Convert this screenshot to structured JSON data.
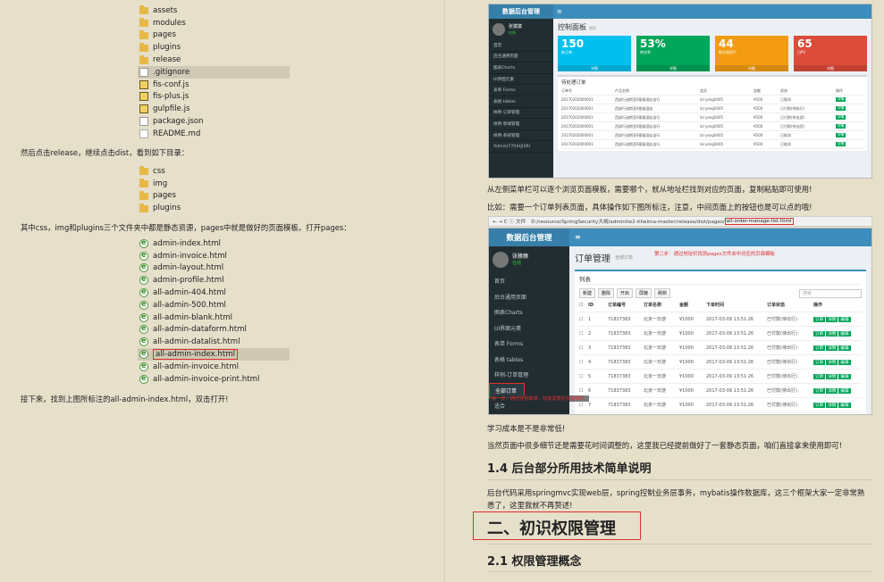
{
  "left": {
    "list1": [
      {
        "name": "assets",
        "type": "folder"
      },
      {
        "name": "modules",
        "type": "folder"
      },
      {
        "name": "pages",
        "type": "folder"
      },
      {
        "name": "plugins",
        "type": "folder"
      },
      {
        "name": "release",
        "type": "folder"
      },
      {
        "name": ".gitignore",
        "type": "file",
        "highlight": true
      },
      {
        "name": "fis-conf.js",
        "type": "js"
      },
      {
        "name": "fis-plus.js",
        "type": "js"
      },
      {
        "name": "gulpfile.js",
        "type": "js"
      },
      {
        "name": "package.json",
        "type": "file"
      },
      {
        "name": "README.md",
        "type": "md"
      }
    ],
    "para1": "然后点击release，继续点击dist，看到如下目录：",
    "list2": [
      {
        "name": "css",
        "type": "folder"
      },
      {
        "name": "img",
        "type": "folder"
      },
      {
        "name": "pages",
        "type": "folder"
      },
      {
        "name": "plugins",
        "type": "folder"
      }
    ],
    "para2": "其中css，img和plugins三个文件夹中都是静态资源，pages中就是做好的页面模板。打开pages：",
    "list3": [
      {
        "name": "admin-index.html"
      },
      {
        "name": "admin-invoice.html"
      },
      {
        "name": "admin-layout.html"
      },
      {
        "name": "admin-profile.html"
      },
      {
        "name": "all-admin-404.html"
      },
      {
        "name": "all-admin-500.html"
      },
      {
        "name": "all-admin-blank.html"
      },
      {
        "name": "all-admin-dataform.html"
      },
      {
        "name": "all-admin-datalist.html"
      },
      {
        "name": "all-admin-index.html",
        "highlight": true
      },
      {
        "name": "all-admin-invoice.html"
      },
      {
        "name": "all-admin-invoice-print.html"
      }
    ],
    "para3": "接下来，找到上图所标注的all-admin-index.html，双击打开!"
  },
  "shot1": {
    "logo": "数据后台管理",
    "user": "张猿猿",
    "online": "在线",
    "nav": [
      "首页",
      "后台通用页面",
      "图表Charts",
      "UI界面元素",
      "表单 Forms",
      "表格 tables",
      "样例-订单管理",
      "样例-新闻管理",
      "样例-系统管理",
      "Admin(770)HJ(SR)"
    ],
    "title": "控制面板",
    "title_small": "首页",
    "boxes": [
      {
        "num": "150",
        "label": "新订单",
        "foot": "详细",
        "color": "#00c0ef"
      },
      {
        "num": "53%",
        "label": "转化率",
        "foot": "详细",
        "color": "#00a65a"
      },
      {
        "num": "44",
        "label": "新注册用户",
        "foot": "详细",
        "color": "#f39c12"
      },
      {
        "num": "65",
        "label": "日PV",
        "foot": "详细",
        "color": "#dd4b39"
      }
    ],
    "table_title": "待处理订单",
    "cols": [
      "订单号",
      "产品名称",
      "会员",
      "金额",
      "状态",
      "操作"
    ],
    "rows": [
      [
        "20170202000001",
        "西部行迪斯亚6星级酒店自行",
        "lal yeng0405",
        "¥500",
        "已取消",
        "详情"
      ],
      [
        "20170202000001",
        "西部行迪斯亚6星级酒店",
        "lal yeng0405",
        "¥500",
        "已付款(待执行)",
        "详情"
      ],
      [
        "20170202000001",
        "西部行迪斯亚6星级酒店自行",
        "lal yeng0405",
        "¥500",
        "已付款(待出游)",
        "详情"
      ],
      [
        "20170202000001",
        "西部行迪斯亚6星级酒店自行",
        "lal yeng0405",
        "¥500",
        "已付款(待出团)",
        "详情"
      ],
      [
        "20170202000001",
        "西部行迪斯亚6星级酒店自行",
        "lal yeng0405",
        "¥500",
        "已取消",
        "详情"
      ],
      [
        "20170202000001",
        "西部行迪斯亚6星级酒店自行",
        "lal yeng0405",
        "¥500",
        "已取消",
        "详情"
      ]
    ]
  },
  "rpara1": "从左侧菜单栏可以逐个浏览页面模板，需要哪个，就从地址栏找到对应的页面，复制粘贴即可使用!",
  "rpara2": "比如：需要一个订单列表页面，具体操作如下图所标注，注意，中间页面上的按钮也是可以点的哦!",
  "browser": {
    "nav": "←  →  C  ⓘ  文件",
    "url_prefix": "D:/resource/SpringSecurity大纲/adminlte2-itheima-master/release/dist/pages/",
    "url_file": "all-order-manage-list.html"
  },
  "shot2": {
    "logo": "数据后台管理",
    "user": "张猿猿",
    "online": "在线",
    "note1": "第二步：通过地址栏找到pages文件夹中对应的页面模板",
    "nav": [
      "首页",
      "后台通用页面",
      "图表Charts",
      "UI界面元素",
      "表单 Forms",
      "表格 tables",
      "样例-订单管理",
      "全部订单",
      "适合"
    ],
    "title": "订单管理",
    "title_small": "全部订单",
    "box_title": "列表",
    "tools": [
      "新建",
      "删除",
      "开启",
      "屏蔽",
      "刷新"
    ],
    "search": "搜索",
    "cols": [
      "ID",
      "订单编号",
      "订单名称",
      "金额",
      "下单时间",
      "订单状态",
      "操作"
    ],
    "rows": [
      [
        "1",
        "71837383",
        "北京一日游",
        "¥1000",
        "2017-03-09 13:51:26",
        "已付款(待出行)"
      ],
      [
        "2",
        "71837383",
        "北京一日游",
        "¥1000",
        "2017-03-09 13:51:26",
        "已付款(待出行)"
      ],
      [
        "3",
        "71837383",
        "北京一日游",
        "¥1000",
        "2017-03-09 13:51:26",
        "已付款(待出行)"
      ],
      [
        "4",
        "71837383",
        "北京一日游",
        "¥1000",
        "2017-03-09 13:51:26",
        "已付款(待出行)"
      ],
      [
        "5",
        "71837383",
        "北京一日游",
        "¥1000",
        "2017-03-09 13:51:26",
        "已付款(待出行)"
      ],
      [
        "6",
        "71837383",
        "北京一日游",
        "¥1000",
        "2017-03-09 13:51:26",
        "已付款(待出行)"
      ],
      [
        "7",
        "71837383",
        "北京一日游",
        "¥1000",
        "2017-03-09 13:51:26",
        "已付款(待出行)"
      ]
    ],
    "row_buttons": [
      "订单",
      "详情",
      "编辑"
    ],
    "note2": "第一步：通过左侧菜单，找到需要的页面模板。"
  },
  "rpara3": "学习成本是不是非常低!",
  "rpara4": "当然页面中很多细节还是需要花时间调整的，这里我已经提前做好了一套静态页面，咱们直接拿来使用即可!",
  "h14": "1.4 后台部分所用技术简单说明",
  "rpara5": "后台代码采用springmvc实现web层，spring控制业务层事务，mybatis操作数据库，这三个框架大家一定非常熟",
  "rpara6": "悉了，这里我就不再赘述!",
  "h2": "二、初识权限管理",
  "h21": "2.1 权限管理概念",
  "colors": {
    "accent_red": "#e03030",
    "admin_blue": "#3c8dbc",
    "sidebar": "#222d32"
  }
}
